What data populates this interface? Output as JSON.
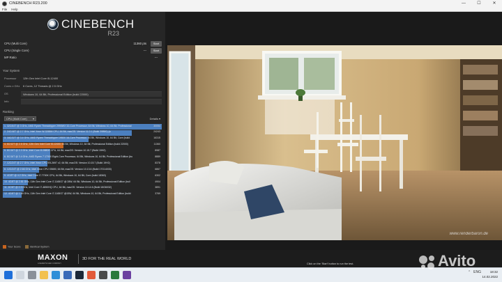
{
  "window": {
    "title": "CINEBENCH R23.200",
    "controls": [
      "—",
      "☐",
      "✕"
    ]
  },
  "menu": [
    "File",
    "Help"
  ],
  "logo": {
    "name": "CINEBENCH",
    "version": "R23"
  },
  "scores": [
    {
      "label": "CPU (Multi Core)",
      "value": "11360 pts",
      "button": "Start"
    },
    {
      "label": "CPU (Single Core)",
      "value": "---",
      "button": "Start"
    },
    {
      "label": "MP Ratio",
      "value": "---"
    }
  ],
  "system": {
    "heading": "Your System",
    "rows": [
      {
        "key": "Processor",
        "value": "12th Gen Intel Core i5-12400"
      },
      {
        "key": "Cores x GHz",
        "value": "6 Cores, 12 Threads @ 2.5 GHz"
      },
      {
        "key": "OS",
        "value": "Windows 10, 64 Bit, Professional Edition (build 22000)"
      },
      {
        "key": "Info",
        "value": ""
      }
    ]
  },
  "ranking": {
    "heading": "Ranking",
    "dropdown": "CPU (Multi Core)",
    "details": "Details",
    "rows": [
      {
        "text": "1. 32C/64T @ 3 GHz, AMD Ryzen Threadripper 2990WX 32-Core Processor, 64 Bit, Windows 10, 64 Bit, Professional",
        "score": "30054",
        "fill": 1.0,
        "color": "#4b7fbf"
      },
      {
        "text": "2. 24C/48T @ 2.7 GHz, Intel Xeon W-3265M CPU, 64 Bit, macOS: Version 11.0.1 (Build 20B50) (a",
        "score": "24243",
        "fill": 0.81,
        "color": "#4b7fbf"
      },
      {
        "text": "3. 16C/32T @ 3.4 GHz, AMD Ryzen Threadripper 1950X 16-Core Processor, 64 Bit, Windows 10, 64 Bit, Core (build",
        "score": "16315",
        "fill": 0.54,
        "color": "#4b7fbf"
      },
      {
        "text": "4. 6C/12T @ 2.5 GHz, 12th Gen Intel Core i5-12400, 64 Bit, Windows 10, 64 Bit, Professional Edition (build 22000)",
        "score": "11360",
        "fill": 0.38,
        "color": "#c8641e"
      },
      {
        "text": "5. 8C/16T @ 2.3 GHz, Intel Core i9-9880H CPU, 64 Bit, macOS: Version 10.15.7 (Build 19H2)",
        "score": "8987",
        "fill": 0.3,
        "color": "#4b7fbf"
      },
      {
        "text": "6. 8C/16T @ 3.4 GHz, AMD Ryzen 7 1700X Eight-Core Processor, 64 Bit, Windows 10, 64 Bit, Professional Edition (bu",
        "score": "8889",
        "fill": 0.3,
        "color": "#4b7fbf"
      },
      {
        "text": "7. 12C/24T @ 2.7 GHz, Intel Xeon CPU E5-2697 v2, 64 Bit, macOS: Version 10.15.7 (Build 19H2)",
        "score": "8378",
        "fill": 0.28,
        "color": "#4b7fbf"
      },
      {
        "text": "8. 12C/24T @ 2.66 GHz, Intel Xeon CPU X5650, 64 Bit, macOS: Version 10.13.6 (Build 17G14033)",
        "score": "6867",
        "fill": 0.23,
        "color": "#4b7fbf"
      },
      {
        "text": "9. 4C/8T @ 4.2 GHz, Intel Core i7-7700K CPU, 64 Bit, Windows 10, 64 Bit, Core (build 18363)",
        "score": "6302",
        "fill": 0.21,
        "color": "#4b7fbf"
      },
      {
        "text": "10. 4C/8T @ 2.81 GHz, 11th Gen Intel Core i7-1165G7 @ 28W, 64 Bit, Windows 10, 64 Bit, Professional Edition (buil",
        "score": "4904",
        "fill": 0.16,
        "color": "#4b7fbf"
      },
      {
        "text": "11. 4C/8T @ 2.3 GHz, Intel Core i7-4850HQ CPU, 64 Bit, macOS: Version 10.14.6 (Build 18G6032)",
        "score": "3891",
        "fill": 0.13,
        "color": "#4b7fbf"
      },
      {
        "text": "12. 4C/8T @ 1.69 GHz, 11th Gen Intel Core i7-1165G7 @15W, 64 Bit, Windows 10, 64 Bit, Professional Edition (build",
        "score": "3769",
        "fill": 0.12,
        "color": "#4b7fbf"
      }
    ]
  },
  "legend": [
    {
      "label": "Your Score",
      "color": "#c8641e"
    },
    {
      "label": "Identical System",
      "color": "#8a6a3a"
    }
  ],
  "render": {
    "watermark": "www.renderbaron.de"
  },
  "footer": {
    "brand": "MAXON",
    "brand_sub": "A NEMETSCHEK COMPANY",
    "tagline": "3D FOR THE REAL WORLD",
    "hint": "Click on the 'Start' button to run the test."
  },
  "taskbar": {
    "clock_time": "18:32",
    "clock_date": "14.02.2022",
    "tray_lang": "ENG"
  },
  "overlay": {
    "avito": "Avito"
  }
}
